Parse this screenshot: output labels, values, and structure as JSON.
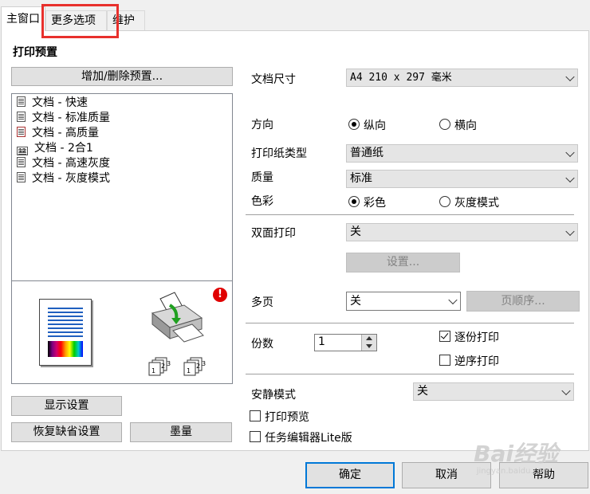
{
  "tabs": [
    {
      "label": "主窗口"
    },
    {
      "label": "更多选项"
    },
    {
      "label": "维护"
    }
  ],
  "left": {
    "section_title": "打印预置",
    "add_delete_label": "增加/删除预置...",
    "presets": [
      {
        "label": "文档 - 快速"
      },
      {
        "label": "文档 - 标准质量"
      },
      {
        "label": "文档 - 高质量"
      },
      {
        "label": "文档 - 2合1"
      },
      {
        "label": "文档 - 高速灰度"
      },
      {
        "label": "文档 - 灰度模式"
      }
    ],
    "show_settings_label": "显示设置",
    "restore_defaults_label": "恢复缺省设置",
    "ink_level_label": "墨量"
  },
  "right": {
    "doc_size": {
      "label": "文档尺寸",
      "value": "A4 210 x 297 毫米"
    },
    "orientation": {
      "label": "方向",
      "portrait": "纵向",
      "landscape": "横向",
      "selected": "portrait"
    },
    "paper_type": {
      "label": "打印纸类型",
      "value": "普通纸"
    },
    "quality": {
      "label": "质量",
      "value": "标准"
    },
    "color": {
      "label": "色彩",
      "color_option": "彩色",
      "gray_option": "灰度模式",
      "selected": "color"
    },
    "duplex": {
      "label": "双面打印",
      "value": "关",
      "settings_label": "设置..."
    },
    "multipage": {
      "label": "多页",
      "value": "关",
      "page_order_label": "页顺序..."
    },
    "copies": {
      "label": "份数",
      "value": "1",
      "collate_label": "逐份打印",
      "collate_checked": true,
      "reverse_label": "逆序打印",
      "reverse_checked": false
    },
    "quiet_mode": {
      "label": "安静模式",
      "value": "关"
    },
    "print_preview": {
      "label": "打印预览",
      "checked": false
    },
    "job_arranger": {
      "label": "任务编辑器Lite版",
      "checked": false
    }
  },
  "footer": {
    "ok_label": "确定",
    "cancel_label": "取消",
    "help_label": "帮助"
  },
  "watermark": {
    "text": "Bai经验",
    "sub": "jingyan.baidu.com"
  },
  "colors": {
    "highlight": "#e8302c",
    "accent": "#0078d7",
    "warning": "#e00000"
  }
}
